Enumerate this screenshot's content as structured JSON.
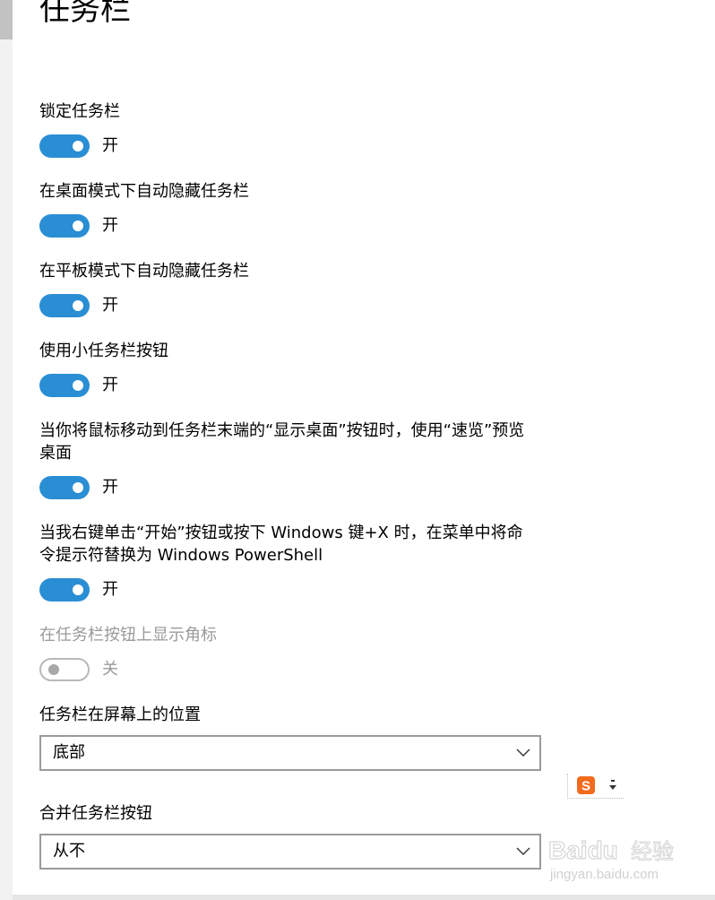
{
  "page": {
    "title": "任务栏"
  },
  "settings": [
    {
      "label": "锁定任务栏",
      "state": "开",
      "on": true,
      "disabled": false
    },
    {
      "label": "在桌面模式下自动隐藏任务栏",
      "state": "开",
      "on": true,
      "disabled": false
    },
    {
      "label": "在平板模式下自动隐藏任务栏",
      "state": "开",
      "on": true,
      "disabled": false
    },
    {
      "label": "使用小任务栏按钮",
      "state": "开",
      "on": true,
      "disabled": false
    },
    {
      "label": "当你将鼠标移动到任务栏末端的“显示桌面”按钮时，使用“速览”预览桌面",
      "state": "开",
      "on": true,
      "disabled": false
    },
    {
      "label": "当我右键单击“开始”按钮或按下 Windows 键+X 时，在菜单中将命令提示符替换为 Windows PowerShell",
      "state": "开",
      "on": true,
      "disabled": false
    },
    {
      "label": "在任务栏按钮上显示角标",
      "state": "关",
      "on": false,
      "disabled": true
    }
  ],
  "position": {
    "label": "任务栏在屏幕上的位置",
    "value": "底部"
  },
  "combine": {
    "label": "合并任务栏按钮",
    "value": "从不"
  },
  "ime": {
    "logo_letter": "S"
  },
  "watermark": {
    "brand": "Baidu",
    "cn": "经验",
    "url": "jingyan.baidu.com"
  },
  "colors": {
    "accent": "#2a8ed4",
    "disabled_text": "#9a9a9a",
    "ime_orange": "#f26b1d"
  },
  "icons": {
    "toggle_knob": "toggle-knob",
    "dropdown": "chevron-down-icon",
    "ime": "sogou-ime-icon"
  }
}
